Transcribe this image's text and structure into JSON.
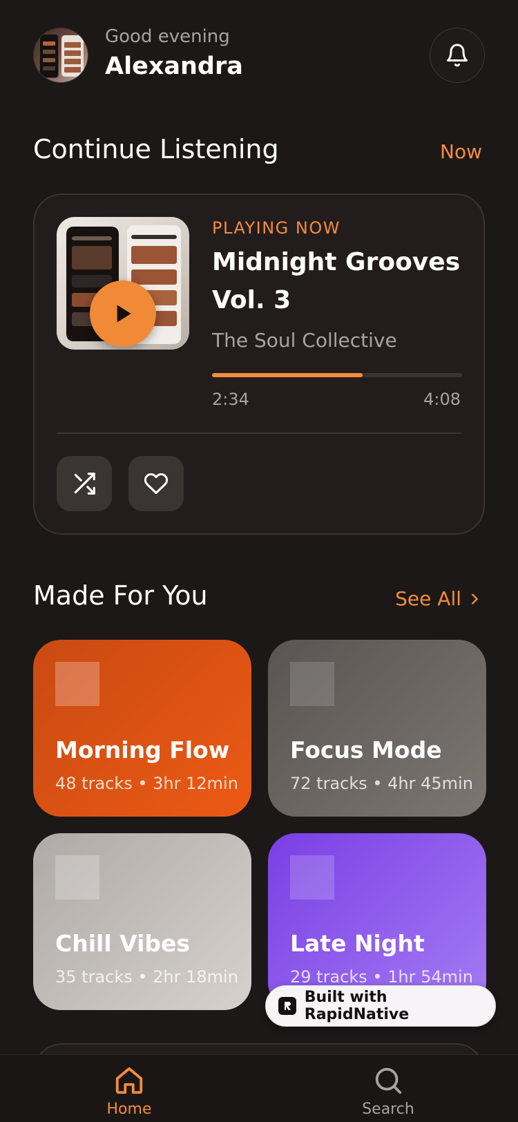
{
  "header": {
    "greeting": "Good evening",
    "username": "Alexandra"
  },
  "continue_listening": {
    "title": "Continue Listening",
    "action_label": "Now",
    "card": {
      "status_label": "PLAYING NOW",
      "track_title": "Midnight Grooves Vol. 3",
      "artist": "The Soul Collective",
      "elapsed": "2:34",
      "duration": "4:08",
      "progress_fraction": 0.603
    }
  },
  "made_for_you": {
    "title": "Made For You",
    "action_label": "See All",
    "playlists": [
      {
        "name": "Morning Flow",
        "meta": "48 tracks • 3hr 12min",
        "color_from": "#c94a12",
        "color_to": "#ec5a14"
      },
      {
        "name": "Focus Mode",
        "meta": "72 tracks • 4hr 45min",
        "color_from": "#5a5552",
        "color_to": "#7c7671"
      },
      {
        "name": "Chill Vibes",
        "meta": "35 tracks • 2hr 18min",
        "color_from": "#b0aaa6",
        "color_to": "#d6d1cd"
      },
      {
        "name": "Late Night",
        "meta": "29 tracks • 1hr 54min",
        "color_from": "#7a3fe4",
        "color_to": "#a47bf4"
      }
    ]
  },
  "badge": {
    "label": "Built with RapidNative"
  },
  "nav": {
    "items": [
      {
        "label": "Home",
        "icon": "home-icon",
        "active": true
      },
      {
        "label": "Search",
        "icon": "search-icon",
        "active": false
      }
    ]
  },
  "colors": {
    "background": "#1c1817",
    "accent": "#f48c3c",
    "card": "#221d1c",
    "muted_text": "#a9a3a0"
  }
}
